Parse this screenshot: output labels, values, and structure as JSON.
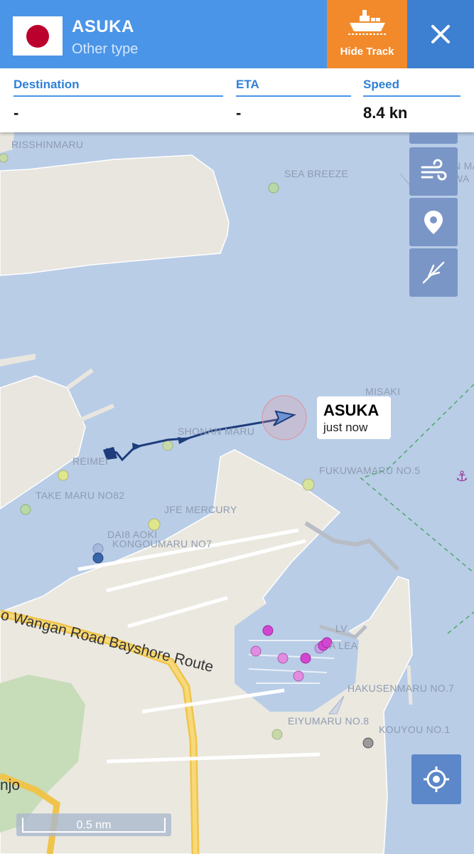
{
  "header": {
    "vessel_name": "ASUKA",
    "vessel_type": "Other type",
    "flag": "japan-flag",
    "hide_track_label": "Hide Track",
    "close_icon": "close-icon",
    "colors": {
      "header_bg": "#4a95e8",
      "hide_track_bg": "#f28a2b",
      "close_bg": "#3d7fd1"
    }
  },
  "info": {
    "destination_label": "Destination",
    "destination_value": "-",
    "eta_label": "ETA",
    "eta_value": "-",
    "speed_label": "Speed",
    "speed_value": "8.4 kn"
  },
  "map": {
    "callout": {
      "name": "ASUKA",
      "time": "just now"
    },
    "labels": {
      "risshinmaru": "RISSHINMARU",
      "sea_breeze": "SEA BREEZE",
      "nan_ma": "NAN MA",
      "newa": "NEWA",
      "misaki": "MISAKI",
      "shonan_maru": "SHONAN MARU",
      "reimei": "REIMEI",
      "fukuwamaru": "FUKUWAMARU NO.5",
      "take_maru": "TAKE MARU NO82",
      "jfe_mercury": "JFE MERCURY",
      "dai8_aoki": "DAI8 AOKI",
      "kongoumaru": "KONGOUMARU NO7",
      "lv": "LV",
      "a_lea": "A LEA",
      "hakusenmaru": "HAKUSENMARU NO.7",
      "eiyumaru": "EIYUMARU NO.8",
      "kouyou": "KOUYOU NO.1",
      "road": "o Wangan Road Bayshore Route",
      "njo": "njo"
    },
    "scale_label": "0.5 nm"
  },
  "controls": [
    "layers-icon",
    "wind-icon",
    "pin-icon",
    "measure-icon",
    "locate-icon"
  ]
}
